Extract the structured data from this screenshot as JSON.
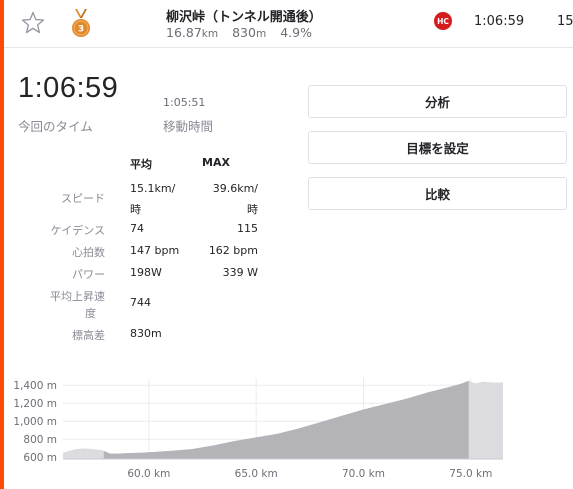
{
  "header": {
    "medal_rank": "3",
    "segment_name": "柳沢峠（トンネル開通後）",
    "distance_value": "16.87",
    "distance_unit": "km",
    "elevation_value": "830",
    "elevation_unit": "m",
    "grade": "4.9%",
    "category_badge": "HC",
    "time": "1:06:59",
    "next_col_partial": "15."
  },
  "summary": {
    "elapsed_time": "1:06:59",
    "elapsed_label": "今回のタイム",
    "moving_time": "1:05:51",
    "moving_label": "移動時間"
  },
  "stats": {
    "col_avg": "平均",
    "col_max": "MAX",
    "rows": [
      {
        "label": "スピード",
        "avg_line1": "15.1km/",
        "avg_line2": "時",
        "max_line1": "39.6km/",
        "max_line2": "時"
      },
      {
        "label": "ケイデンス",
        "avg": "74",
        "max": "115"
      },
      {
        "label": "心拍数",
        "avg": "147 bpm",
        "max": "162 bpm"
      },
      {
        "label": "パワー",
        "avg": "198W",
        "max": "339 W"
      },
      {
        "label_line1": "平均上昇速",
        "label_line2": "度",
        "avg": "744"
      },
      {
        "label": "標高差",
        "avg": "830m"
      }
    ]
  },
  "actions": {
    "analyze": "分析",
    "set_goal": "目標を設定",
    "compare": "比較"
  },
  "colors": {
    "accent": "#fc4c02",
    "hc_badge": "#d41c1c",
    "medal_bronze": "#e08a2c"
  },
  "chart_data": {
    "type": "area",
    "title": "",
    "xlabel": "",
    "ylabel": "",
    "x_ticks": [
      "60.0 km",
      "65.0 km",
      "70.0 km",
      "75.0 km"
    ],
    "y_ticks": [
      "600 m",
      "800 m",
      "1,000 m",
      "1,200 m",
      "1,400 m"
    ],
    "xlim": [
      56.0,
      76.5
    ],
    "ylim": [
      580,
      1480
    ],
    "segment_range_km": [
      57.9,
      74.9
    ],
    "grid": true,
    "series": [
      {
        "x": [
          56.0,
          56.2,
          56.6,
          57.0,
          57.4,
          57.8,
          58.2,
          58.6,
          59.0,
          59.6,
          60.2,
          61.0,
          62.0,
          63.0,
          64.0,
          65.0,
          66.0,
          67.0,
          68.0,
          69.0,
          70.0,
          71.0,
          72.0,
          73.0,
          74.0,
          74.6,
          74.9,
          75.2,
          75.6,
          76.0,
          76.5
        ],
        "values": [
          650,
          665,
          690,
          698,
          690,
          680,
          640,
          640,
          645,
          650,
          658,
          670,
          690,
          730,
          780,
          820,
          860,
          920,
          990,
          1060,
          1130,
          1190,
          1250,
          1320,
          1380,
          1420,
          1450,
          1420,
          1440,
          1430,
          1430
        ]
      }
    ]
  }
}
